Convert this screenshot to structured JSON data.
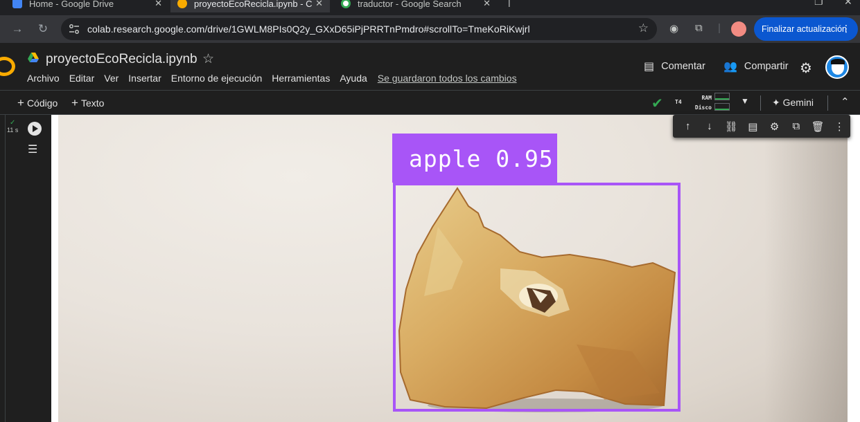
{
  "browser": {
    "tabs": [
      {
        "title": "Home - Google Drive"
      },
      {
        "title": "proyectoEcoRecicla.ipynb - Colab"
      },
      {
        "title": "traductor - Google Search"
      }
    ],
    "url": "colab.research.google.com/drive/1GWLM8PIs0Q2y_GXxD65iPjPRRTnPmdro#scrollTo=TmeKoRiKwjrl",
    "update_button": "Finalizar actualización"
  },
  "colab": {
    "notebook_title": "proyectoEcoRecicla.ipynb",
    "menu": [
      "Archivo",
      "Editar",
      "Ver",
      "Insertar",
      "Entorno de ejecución",
      "Herramientas",
      "Ayuda"
    ],
    "saved_status": "Se guardaron todos los cambios",
    "comment_label": "Comentar",
    "share_label": "Compartir",
    "toolbar": {
      "add_code": "Código",
      "add_text": "Texto",
      "runtime": "T4",
      "ram_label": "RAM",
      "disk_label": "Disco",
      "gemini": "Gemini"
    },
    "cell": {
      "exec_time": "11 s"
    },
    "output": {
      "detection_label": "apple 0.95"
    }
  },
  "colors": {
    "accent": "#0b57d0",
    "bbox": "#a855f7",
    "ok": "#34a853"
  }
}
